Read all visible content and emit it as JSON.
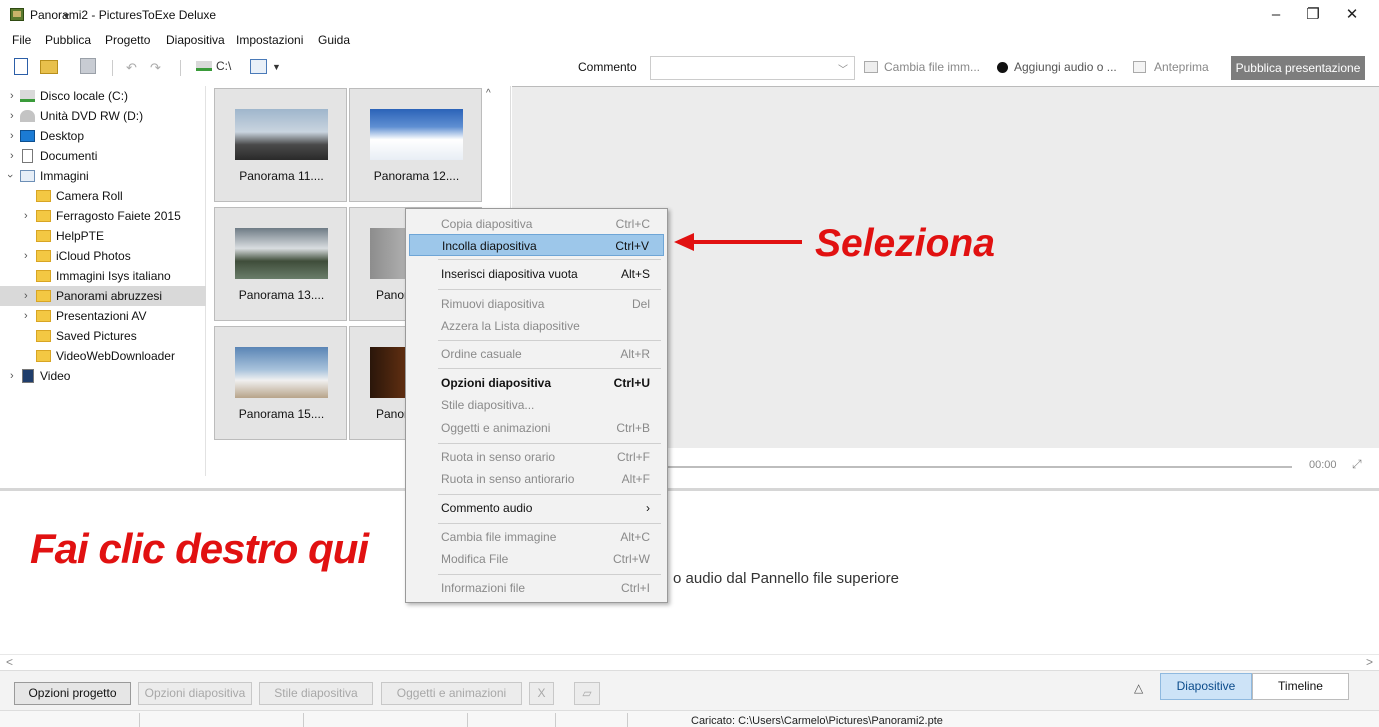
{
  "window": {
    "title": "Panorami2 - PicturesToExe Deluxe",
    "minimize": "–",
    "maximize": "❐",
    "close": "✕"
  },
  "menu": [
    "File",
    "Pubblica",
    "Progetto",
    "Diapositiva",
    "Impostazioni",
    "Guida"
  ],
  "toolbar": {
    "drive": "C:\\",
    "comment_label": "Commento",
    "change_image": "Cambia file imm...",
    "add_audio": "Aggiungi audio o ...",
    "preview": "Anteprima",
    "publish": "Pubblica presentazione"
  },
  "tree": {
    "items": [
      {
        "label": "Disco locale (C:)"
      },
      {
        "label": "Unità DVD RW (D:)"
      },
      {
        "label": "Desktop"
      },
      {
        "label": "Documenti"
      },
      {
        "label": "Immagini"
      },
      {
        "label": "Camera Roll"
      },
      {
        "label": "Ferragosto Faiete 2015"
      },
      {
        "label": "HelpPTE"
      },
      {
        "label": "iCloud Photos"
      },
      {
        "label": "Immagini Isys italiano"
      },
      {
        "label": "Panorami abruzzesi"
      },
      {
        "label": "Presentazioni AV"
      },
      {
        "label": "Saved Pictures"
      },
      {
        "label": "VideoWebDownloader"
      },
      {
        "label": "Video"
      }
    ]
  },
  "thumbnails": [
    {
      "label": "Panorama 11...."
    },
    {
      "label": "Panorama 12...."
    },
    {
      "label": "Panorama 13...."
    },
    {
      "label": "Panor"
    },
    {
      "label": "Panorama 15...."
    },
    {
      "label": "Panor"
    }
  ],
  "preview": {
    "time": "00:00"
  },
  "context_menu": {
    "items": [
      {
        "label": "Copia diapositiva",
        "shortcut": "Ctrl+C"
      },
      {
        "label": "Incolla diapositiva",
        "shortcut": "Ctrl+V"
      },
      {
        "label": "Inserisci diapositiva vuota",
        "shortcut": "Alt+S"
      },
      {
        "label": "Rimuovi diapositiva",
        "shortcut": "Del"
      },
      {
        "label": "Azzera la Lista diapositive",
        "shortcut": ""
      },
      {
        "label": "Ordine casuale",
        "shortcut": "Alt+R"
      },
      {
        "label": "Opzioni diapositiva",
        "shortcut": "Ctrl+U"
      },
      {
        "label": "Stile diapositiva...",
        "shortcut": ""
      },
      {
        "label": "Oggetti e animazioni",
        "shortcut": "Ctrl+B"
      },
      {
        "label": "Ruota in senso orario",
        "shortcut": "Ctrl+F"
      },
      {
        "label": "Ruota in senso antiorario",
        "shortcut": "Alt+F"
      },
      {
        "label": "Commento audio",
        "shortcut": "›"
      },
      {
        "label": "Cambia file immagine",
        "shortcut": "Alt+C"
      },
      {
        "label": "Modifica File",
        "shortcut": "Ctrl+W"
      },
      {
        "label": "Informazioni file",
        "shortcut": "Ctrl+I"
      }
    ]
  },
  "slides": {
    "hint": "o audio dal Pannello file superiore"
  },
  "annotations": {
    "right_click": "Fai clic destro qui",
    "select": "Seleziona"
  },
  "bottom": {
    "project_options": "Opzioni progetto",
    "slide_options": "Opzioni diapositiva",
    "slide_style": "Stile diapositiva",
    "objects_animations": "Oggetti e animazioni",
    "x": "X",
    "tab_slides": "Diapositive",
    "tab_timeline": "Timeline"
  },
  "status": {
    "loaded": "Caricato: C:\\Users\\Carmelo\\Pictures\\Panorami2.pte"
  },
  "colors": {
    "annotation_red": "#e11111",
    "highlight": "#9dc7ea",
    "publish_bg": "#7d7d7d"
  }
}
